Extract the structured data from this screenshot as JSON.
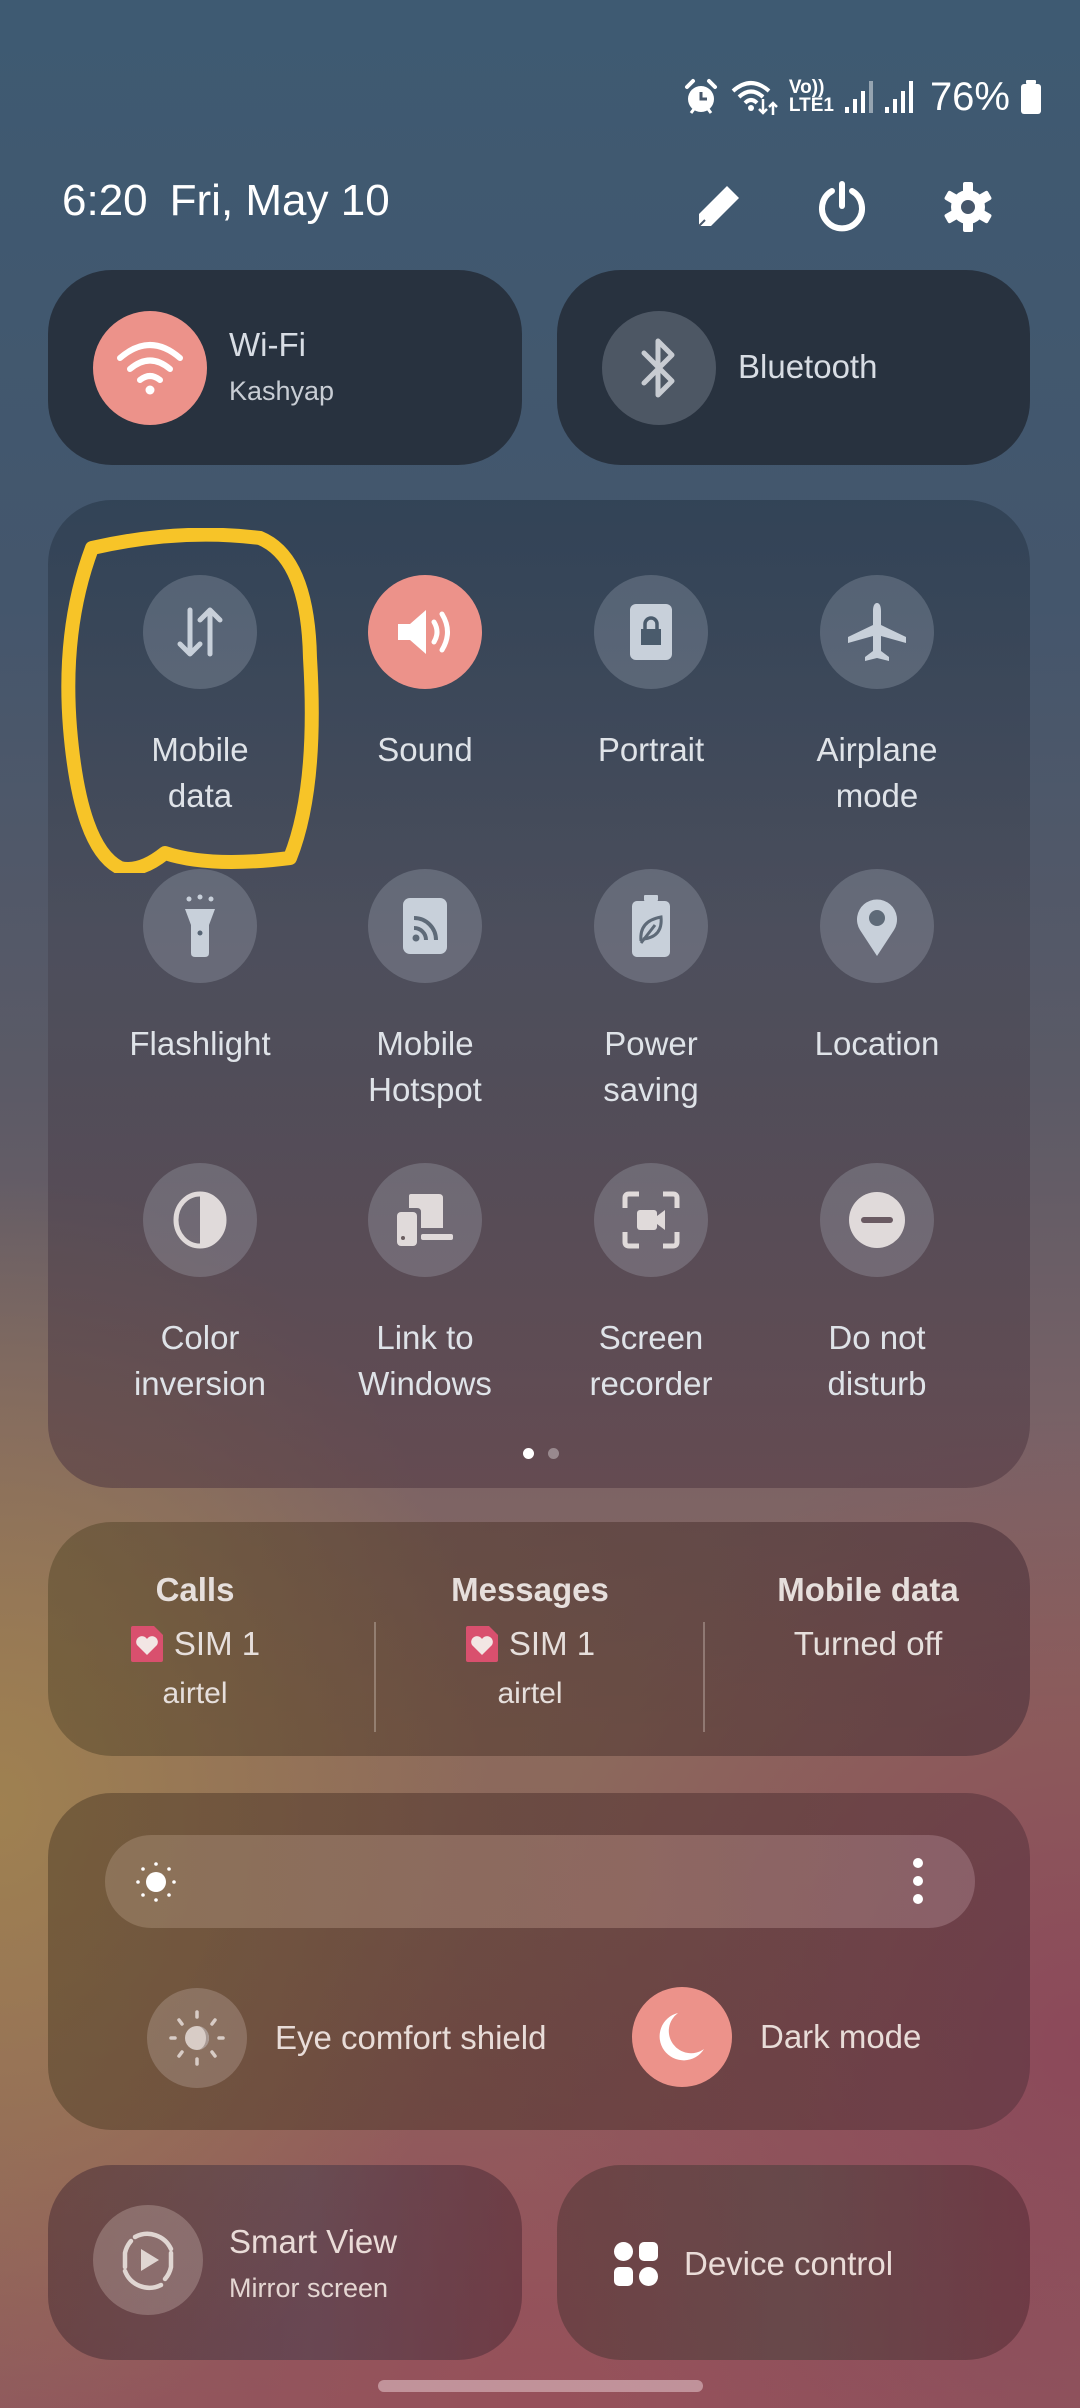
{
  "status_bar": {
    "icons": [
      "alarm-icon",
      "wifi-icon",
      "volte-lte-icon",
      "signal-sim1-icon",
      "signal-sim2-icon",
      "battery-icon"
    ],
    "volte_label": "Vo))",
    "lte_label": "LTE1",
    "battery_percent": "76%"
  },
  "header": {
    "time": "6:20",
    "date": "Fri, May 10",
    "actions": [
      {
        "name": "edit",
        "icon": "pencil-icon"
      },
      {
        "name": "power",
        "icon": "power-icon"
      },
      {
        "name": "settings",
        "icon": "gear-icon"
      }
    ]
  },
  "connectivity": {
    "wifi": {
      "title": "Wi-Fi",
      "subtitle": "Kashyap",
      "state": "on"
    },
    "bluetooth": {
      "title": "Bluetooth",
      "state": "off"
    }
  },
  "quick_tiles": [
    {
      "label_1": "Mobile",
      "label_2": "data",
      "icon": "mobile-data-icon",
      "state": "off",
      "highlighted": true
    },
    {
      "label_1": "Sound",
      "label_2": "",
      "icon": "sound-icon",
      "state": "on"
    },
    {
      "label_1": "Portrait",
      "label_2": "",
      "icon": "portrait-lock-icon",
      "state": "off"
    },
    {
      "label_1": "Airplane",
      "label_2": "mode",
      "icon": "airplane-icon",
      "state": "off"
    },
    {
      "label_1": "Flashlight",
      "label_2": "",
      "icon": "flashlight-icon",
      "state": "off"
    },
    {
      "label_1": "Mobile",
      "label_2": "Hotspot",
      "icon": "hotspot-icon",
      "state": "off"
    },
    {
      "label_1": "Power",
      "label_2": "saving",
      "icon": "power-saving-icon",
      "state": "off"
    },
    {
      "label_1": "Location",
      "label_2": "",
      "icon": "location-icon",
      "state": "off"
    },
    {
      "label_1": "Color",
      "label_2": "inversion",
      "icon": "color-inversion-icon",
      "state": "off"
    },
    {
      "label_1": "Link to",
      "label_2": "Windows",
      "icon": "link-to-windows-icon",
      "state": "off"
    },
    {
      "label_1": "Screen",
      "label_2": "recorder",
      "icon": "screen-recorder-icon",
      "state": "off"
    },
    {
      "label_1": "Do not",
      "label_2": "disturb",
      "icon": "do-not-disturb-icon",
      "state": "off"
    }
  ],
  "pagination": {
    "current_page": 1,
    "total_pages": 2
  },
  "sim_manager": {
    "calls": {
      "title": "Calls",
      "sim": "SIM 1",
      "carrier": "airtel"
    },
    "messages": {
      "title": "Messages",
      "sim": "SIM 1",
      "carrier": "airtel"
    },
    "mobile_data": {
      "title": "Mobile data",
      "status": "Turned off"
    }
  },
  "display": {
    "brightness_icon": "sun-icon",
    "more_icon": "more-vertical-icon",
    "eye_comfort": {
      "label": "Eye comfort shield",
      "state": "off"
    },
    "dark_mode": {
      "label": "Dark mode",
      "state": "on"
    }
  },
  "bottom_cards": {
    "smart_view": {
      "title": "Smart View",
      "subtitle": "Mirror screen"
    },
    "device_control": {
      "title": "Device control"
    }
  },
  "colors": {
    "accent_on": "#ec928a",
    "annotation_yellow": "#f7c428",
    "sim_badge": "#d9506e"
  }
}
